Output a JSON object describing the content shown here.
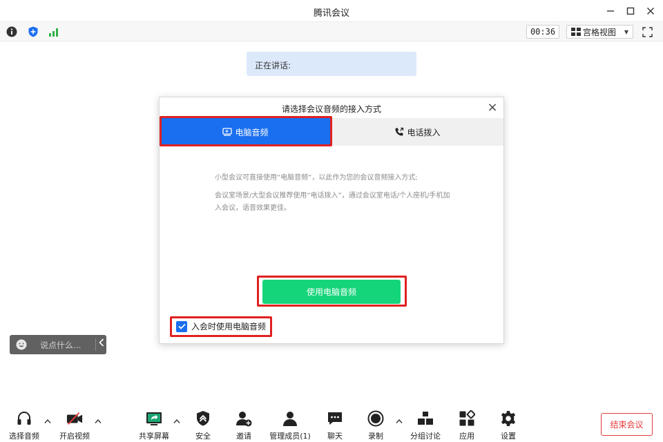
{
  "window": {
    "title": "腾讯会议"
  },
  "infobar": {
    "timer": "00:36",
    "view_label": "宫格视图"
  },
  "speaking": {
    "label": "正在讲话:"
  },
  "dialog": {
    "title": "请选择会议音频的接入方式",
    "tabs": [
      {
        "label": "电脑音频",
        "active": true
      },
      {
        "label": "电话拨入",
        "active": false
      }
    ],
    "desc1": "小型会议可直接使用“电脑音频”，以此作为您的会议音频接入方式;",
    "desc2": "会议室场景/大型会议推荐使用“电话拨入”，通过会议室电话/个人座机/手机加入会议，语音效果更佳。",
    "primary_button": "使用电脑音频",
    "checkbox_label": "入会时使用电脑音频",
    "checkbox_checked": true
  },
  "chat": {
    "placeholder": "说点什么..."
  },
  "toolbar": {
    "items": [
      {
        "label": "选择音频"
      },
      {
        "label": "开启视频"
      },
      {
        "label": "共享屏幕"
      },
      {
        "label": "安全"
      },
      {
        "label": "邀请"
      },
      {
        "label": "管理成员(1)"
      },
      {
        "label": "聊天"
      },
      {
        "label": "录制"
      },
      {
        "label": "分组讨论"
      },
      {
        "label": "应用"
      },
      {
        "label": "设置"
      }
    ],
    "end_label": "结束会议"
  },
  "colors": {
    "accent_blue": "#1a6ff0",
    "green": "#15d57a",
    "red": "#e53a3a"
  }
}
